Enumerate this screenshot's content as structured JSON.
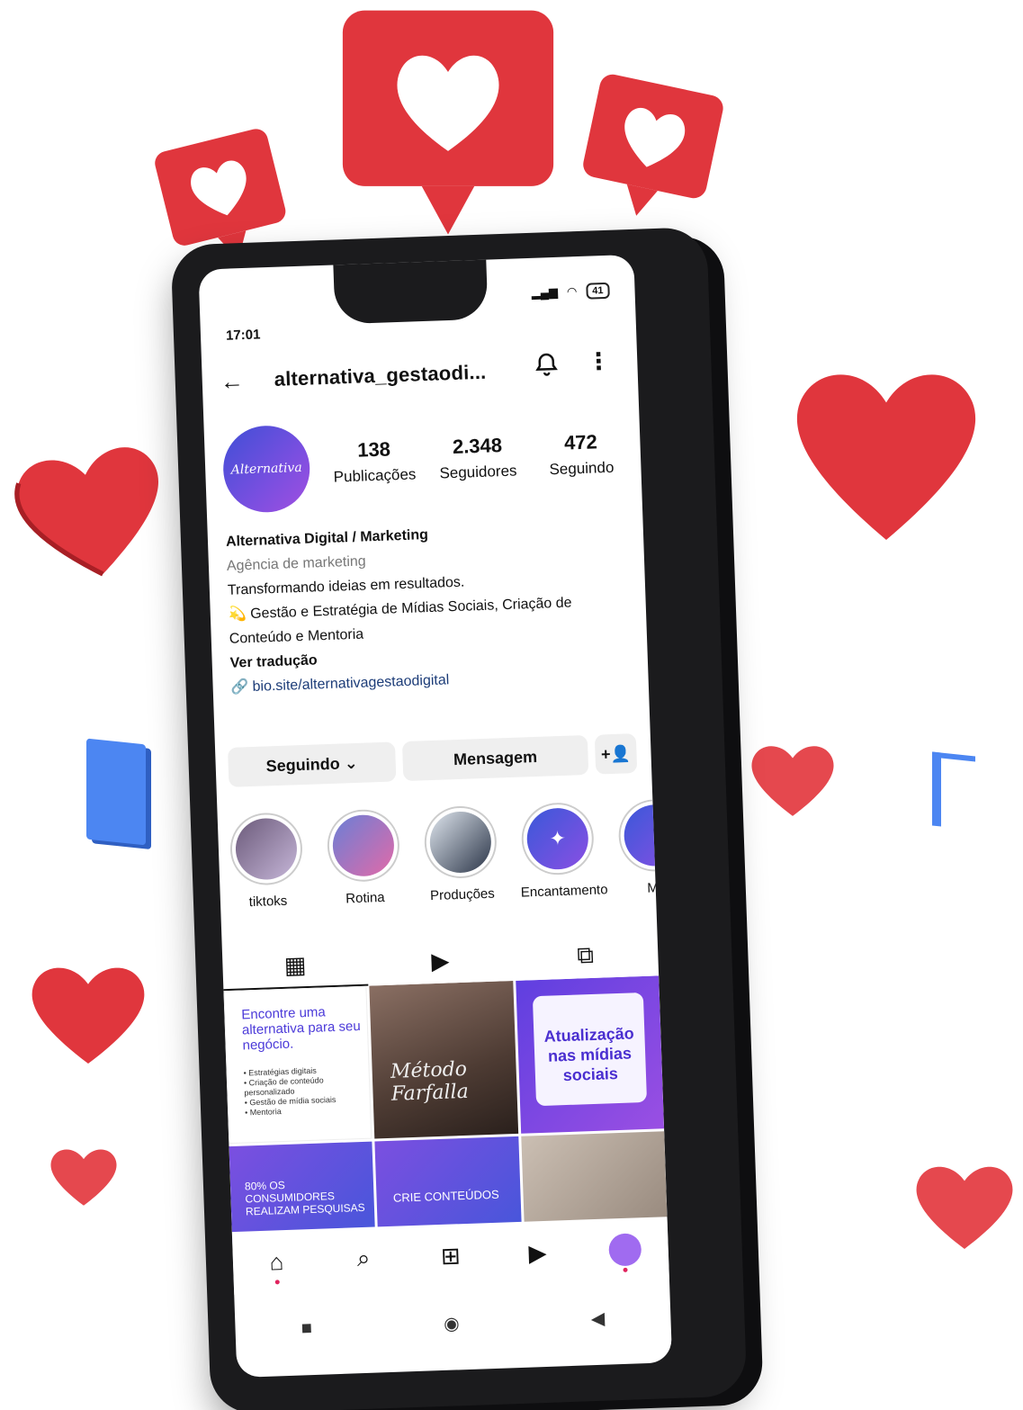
{
  "status_bar": {
    "time": "17:01",
    "battery": "41"
  },
  "header": {
    "username": "alternativa_gestaodi..."
  },
  "profile": {
    "avatar_text": "Alternativa",
    "stats": [
      {
        "value": "138",
        "label": "Publicações"
      },
      {
        "value": "2.348",
        "label": "Seguidores"
      },
      {
        "value": "472",
        "label": "Seguindo"
      }
    ],
    "bio": {
      "name": "Alternativa Digital / Marketing",
      "category": "Agência de marketing",
      "line1": "Transformando ideias em resultados.",
      "line2": "💫 Gestão e Estratégia de Mídias Sociais, Criação de Conteúdo e Mentoria",
      "translate": "Ver tradução",
      "link": "bio.site/alternativagestaodigital"
    }
  },
  "actions": {
    "following": "Seguindo ⌄",
    "message": "Mensagem",
    "add_person": "+👤"
  },
  "highlights": [
    {
      "label": "tiktoks"
    },
    {
      "label": "Rotina"
    },
    {
      "label": "Produções"
    },
    {
      "label": "Encantamento"
    },
    {
      "label": "Me"
    }
  ],
  "grid": {
    "post1_heading": "Encontre uma alternativa para seu negócio.",
    "post1_list": "• Estratégias digitais\n• Criação de conteúdo personalizado\n• Gestão de mídia sociais\n• Mentoria",
    "post2_signature": "Método Farfalla",
    "post3_text": "Atualização nas mídias sociais",
    "post4_text": "80% OS CONSUMIDORES REALIZAM PESQUISAS",
    "post5_text": "CRIE CONTEÚDOS"
  },
  "colors": {
    "heart": "#e0363d",
    "accent": "#7a4fe0",
    "link": "#1c3c78"
  }
}
